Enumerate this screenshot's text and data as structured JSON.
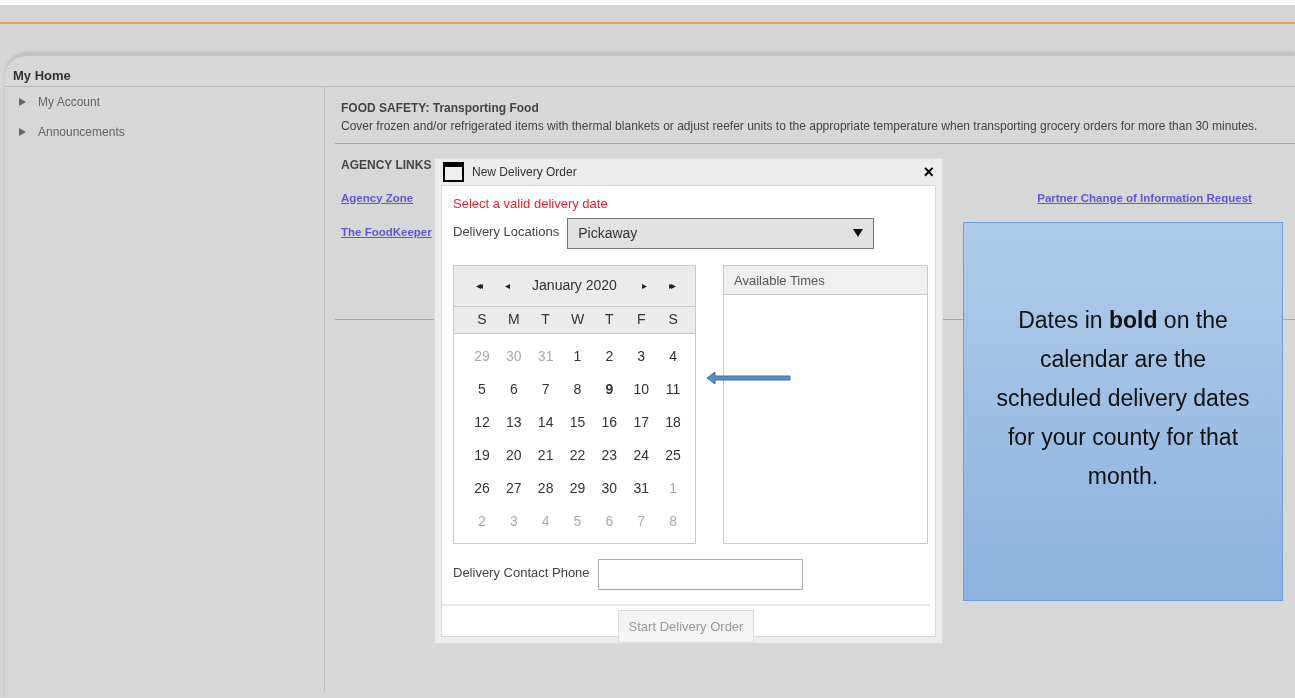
{
  "page_title": "My Home",
  "sidebar": {
    "items": [
      {
        "label": "My Account",
        "expanded": false
      },
      {
        "label": "Announcements",
        "expanded": false
      }
    ]
  },
  "notice": {
    "title": "FOOD SAFETY: Transporting Food",
    "text": "Cover frozen and/or refrigerated items with thermal blankets or adjust reefer units to the appropriate temperature when transporting grocery orders for more than 30 minutes."
  },
  "agency_links": {
    "heading": "AGENCY LINKS",
    "links": [
      "Agency Zone",
      "The FoodKeeper",
      "Partner Change of Information Request"
    ]
  },
  "dialog": {
    "title": "New Delivery Order",
    "close": "×",
    "error": "Select a valid delivery date",
    "location_label": "Delivery Locations",
    "location_value": "Pickaway",
    "calendar": {
      "month": "January 2020",
      "nav": [
        "◂◂",
        "◂",
        "▸",
        "▸▸"
      ],
      "weekdays": [
        "S",
        "M",
        "T",
        "W",
        "T",
        "F",
        "S"
      ],
      "weeks": [
        [
          {
            "day": "29",
            "other_month": true,
            "bold": false
          },
          {
            "day": "30",
            "other_month": true,
            "bold": false
          },
          {
            "day": "31",
            "other_month": true,
            "bold": false
          },
          {
            "day": "1",
            "other_month": false,
            "bold": false
          },
          {
            "day": "2",
            "other_month": false,
            "bold": false
          },
          {
            "day": "3",
            "other_month": false,
            "bold": false
          },
          {
            "day": "4",
            "other_month": false,
            "bold": false
          }
        ],
        [
          {
            "day": "5",
            "other_month": false,
            "bold": false
          },
          {
            "day": "6",
            "other_month": false,
            "bold": false
          },
          {
            "day": "7",
            "other_month": false,
            "bold": false
          },
          {
            "day": "8",
            "other_month": false,
            "bold": false
          },
          {
            "day": "9",
            "other_month": false,
            "bold": true
          },
          {
            "day": "10",
            "other_month": false,
            "bold": false
          },
          {
            "day": "11",
            "other_month": false,
            "bold": false
          }
        ],
        [
          {
            "day": "12",
            "other_month": false,
            "bold": false
          },
          {
            "day": "13",
            "other_month": false,
            "bold": false
          },
          {
            "day": "14",
            "other_month": false,
            "bold": false
          },
          {
            "day": "15",
            "other_month": false,
            "bold": false
          },
          {
            "day": "16",
            "other_month": false,
            "bold": false
          },
          {
            "day": "17",
            "other_month": false,
            "bold": false
          },
          {
            "day": "18",
            "other_month": false,
            "bold": false
          }
        ],
        [
          {
            "day": "19",
            "other_month": false,
            "bold": false
          },
          {
            "day": "20",
            "other_month": false,
            "bold": false
          },
          {
            "day": "21",
            "other_month": false,
            "bold": false
          },
          {
            "day": "22",
            "other_month": false,
            "bold": false
          },
          {
            "day": "23",
            "other_month": false,
            "bold": false
          },
          {
            "day": "24",
            "other_month": false,
            "bold": false
          },
          {
            "day": "25",
            "other_month": false,
            "bold": false
          }
        ],
        [
          {
            "day": "26",
            "other_month": false,
            "bold": false
          },
          {
            "day": "27",
            "other_month": false,
            "bold": false
          },
          {
            "day": "28",
            "other_month": false,
            "bold": false
          },
          {
            "day": "29",
            "other_month": false,
            "bold": false
          },
          {
            "day": "30",
            "other_month": false,
            "bold": false
          },
          {
            "day": "31",
            "other_month": false,
            "bold": false
          },
          {
            "day": "1",
            "other_month": true,
            "bold": false
          }
        ],
        [
          {
            "day": "2",
            "other_month": true,
            "bold": false
          },
          {
            "day": "3",
            "other_month": true,
            "bold": false
          },
          {
            "day": "4",
            "other_month": true,
            "bold": false
          },
          {
            "day": "5",
            "other_month": true,
            "bold": false
          },
          {
            "day": "6",
            "other_month": true,
            "bold": false
          },
          {
            "day": "7",
            "other_month": true,
            "bold": false
          },
          {
            "day": "8",
            "other_month": true,
            "bold": false
          }
        ]
      ]
    },
    "times_header": "Available Times",
    "phone_label": "Delivery Contact Phone",
    "start_button": {
      "label": "Start Delivery Order",
      "disabled": true
    }
  },
  "callout": "Dates in **bold** on the calendar are the scheduled delivery dates for your county for that month."
}
